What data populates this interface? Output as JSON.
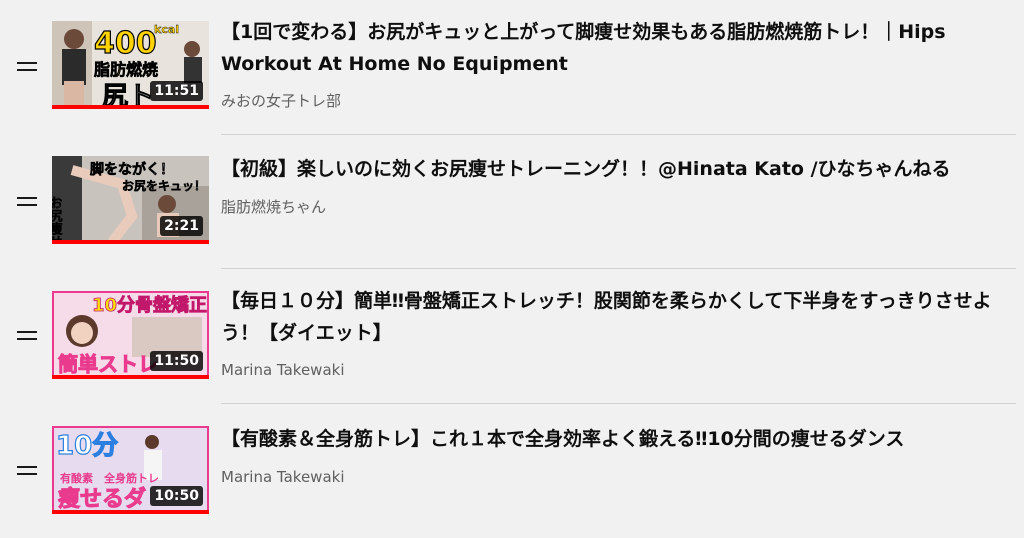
{
  "playlist": {
    "items": [
      {
        "title": "【1回で変わる】お尻がキュッと上がって脚痩せ効果もある脂肪燃焼筋トレ！｜Hips Workout At Home No Equipment",
        "channel": "みおの女子トレ部",
        "duration": "11:51",
        "thumbnail_text": [
          "400",
          "kcal",
          "脂肪燃焼",
          "尻ト"
        ],
        "watched_fraction": 1.0
      },
      {
        "title": "【初級】楽しいのに効くお尻痩せトレーニング！！@Hinata Kato /ひなちゃんねる",
        "channel": "脂肪燃焼ちゃん",
        "duration": "2:21",
        "thumbnail_text": [
          "脚をながく！",
          "お尻をキュッ！",
          "お尻痩せ"
        ],
        "watched_fraction": 1.0
      },
      {
        "title": "【毎日１０分】簡単‼骨盤矯正ストレッチ！股関節を柔らかくして下半身をすっきりさせよう！【ダイエット】",
        "channel": "Marina Takewaki",
        "duration": "11:50",
        "thumbnail_text": [
          "10分骨盤矯正",
          "簡単ストレ"
        ],
        "watched_fraction": 1.0
      },
      {
        "title": "【有酸素＆全身筋トレ】これ１本で全身効率よく鍛える‼10分間の痩せるダンス",
        "channel": "Marina Takewaki",
        "duration": "10:50",
        "thumbnail_text": [
          "10分",
          "有酸素",
          "全身筋トレ",
          "痩せるダ"
        ],
        "watched_fraction": 1.0
      }
    ]
  },
  "colors": {
    "background": "#f1f1f1",
    "progress": "#ff0000",
    "title_text": "#0f0f0f",
    "channel_text": "#606060",
    "pink_accent": "#e93a8d"
  },
  "icons": {
    "drag_handle": "drag-handle-icon"
  }
}
